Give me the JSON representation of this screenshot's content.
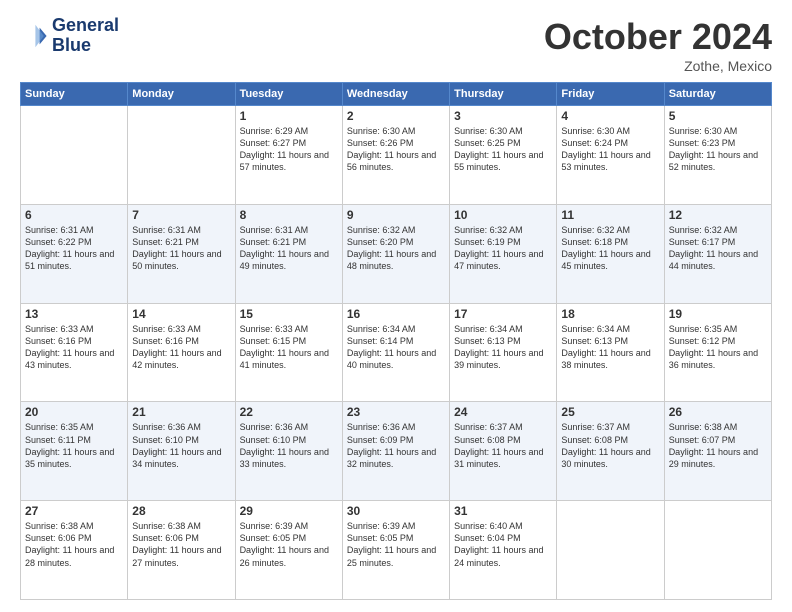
{
  "logo": {
    "line1": "General",
    "line2": "Blue"
  },
  "header": {
    "month": "October 2024",
    "location": "Zothe, Mexico"
  },
  "columns": [
    "Sunday",
    "Monday",
    "Tuesday",
    "Wednesday",
    "Thursday",
    "Friday",
    "Saturday"
  ],
  "weeks": [
    [
      {
        "day": "",
        "info": ""
      },
      {
        "day": "",
        "info": ""
      },
      {
        "day": "1",
        "info": "Sunrise: 6:29 AM\nSunset: 6:27 PM\nDaylight: 11 hours and 57 minutes."
      },
      {
        "day": "2",
        "info": "Sunrise: 6:30 AM\nSunset: 6:26 PM\nDaylight: 11 hours and 56 minutes."
      },
      {
        "day": "3",
        "info": "Sunrise: 6:30 AM\nSunset: 6:25 PM\nDaylight: 11 hours and 55 minutes."
      },
      {
        "day": "4",
        "info": "Sunrise: 6:30 AM\nSunset: 6:24 PM\nDaylight: 11 hours and 53 minutes."
      },
      {
        "day": "5",
        "info": "Sunrise: 6:30 AM\nSunset: 6:23 PM\nDaylight: 11 hours and 52 minutes."
      }
    ],
    [
      {
        "day": "6",
        "info": "Sunrise: 6:31 AM\nSunset: 6:22 PM\nDaylight: 11 hours and 51 minutes."
      },
      {
        "day": "7",
        "info": "Sunrise: 6:31 AM\nSunset: 6:21 PM\nDaylight: 11 hours and 50 minutes."
      },
      {
        "day": "8",
        "info": "Sunrise: 6:31 AM\nSunset: 6:21 PM\nDaylight: 11 hours and 49 minutes."
      },
      {
        "day": "9",
        "info": "Sunrise: 6:32 AM\nSunset: 6:20 PM\nDaylight: 11 hours and 48 minutes."
      },
      {
        "day": "10",
        "info": "Sunrise: 6:32 AM\nSunset: 6:19 PM\nDaylight: 11 hours and 47 minutes."
      },
      {
        "day": "11",
        "info": "Sunrise: 6:32 AM\nSunset: 6:18 PM\nDaylight: 11 hours and 45 minutes."
      },
      {
        "day": "12",
        "info": "Sunrise: 6:32 AM\nSunset: 6:17 PM\nDaylight: 11 hours and 44 minutes."
      }
    ],
    [
      {
        "day": "13",
        "info": "Sunrise: 6:33 AM\nSunset: 6:16 PM\nDaylight: 11 hours and 43 minutes."
      },
      {
        "day": "14",
        "info": "Sunrise: 6:33 AM\nSunset: 6:16 PM\nDaylight: 11 hours and 42 minutes."
      },
      {
        "day": "15",
        "info": "Sunrise: 6:33 AM\nSunset: 6:15 PM\nDaylight: 11 hours and 41 minutes."
      },
      {
        "day": "16",
        "info": "Sunrise: 6:34 AM\nSunset: 6:14 PM\nDaylight: 11 hours and 40 minutes."
      },
      {
        "day": "17",
        "info": "Sunrise: 6:34 AM\nSunset: 6:13 PM\nDaylight: 11 hours and 39 minutes."
      },
      {
        "day": "18",
        "info": "Sunrise: 6:34 AM\nSunset: 6:13 PM\nDaylight: 11 hours and 38 minutes."
      },
      {
        "day": "19",
        "info": "Sunrise: 6:35 AM\nSunset: 6:12 PM\nDaylight: 11 hours and 36 minutes."
      }
    ],
    [
      {
        "day": "20",
        "info": "Sunrise: 6:35 AM\nSunset: 6:11 PM\nDaylight: 11 hours and 35 minutes."
      },
      {
        "day": "21",
        "info": "Sunrise: 6:36 AM\nSunset: 6:10 PM\nDaylight: 11 hours and 34 minutes."
      },
      {
        "day": "22",
        "info": "Sunrise: 6:36 AM\nSunset: 6:10 PM\nDaylight: 11 hours and 33 minutes."
      },
      {
        "day": "23",
        "info": "Sunrise: 6:36 AM\nSunset: 6:09 PM\nDaylight: 11 hours and 32 minutes."
      },
      {
        "day": "24",
        "info": "Sunrise: 6:37 AM\nSunset: 6:08 PM\nDaylight: 11 hours and 31 minutes."
      },
      {
        "day": "25",
        "info": "Sunrise: 6:37 AM\nSunset: 6:08 PM\nDaylight: 11 hours and 30 minutes."
      },
      {
        "day": "26",
        "info": "Sunrise: 6:38 AM\nSunset: 6:07 PM\nDaylight: 11 hours and 29 minutes."
      }
    ],
    [
      {
        "day": "27",
        "info": "Sunrise: 6:38 AM\nSunset: 6:06 PM\nDaylight: 11 hours and 28 minutes."
      },
      {
        "day": "28",
        "info": "Sunrise: 6:38 AM\nSunset: 6:06 PM\nDaylight: 11 hours and 27 minutes."
      },
      {
        "day": "29",
        "info": "Sunrise: 6:39 AM\nSunset: 6:05 PM\nDaylight: 11 hours and 26 minutes."
      },
      {
        "day": "30",
        "info": "Sunrise: 6:39 AM\nSunset: 6:05 PM\nDaylight: 11 hours and 25 minutes."
      },
      {
        "day": "31",
        "info": "Sunrise: 6:40 AM\nSunset: 6:04 PM\nDaylight: 11 hours and 24 minutes."
      },
      {
        "day": "",
        "info": ""
      },
      {
        "day": "",
        "info": ""
      }
    ]
  ]
}
